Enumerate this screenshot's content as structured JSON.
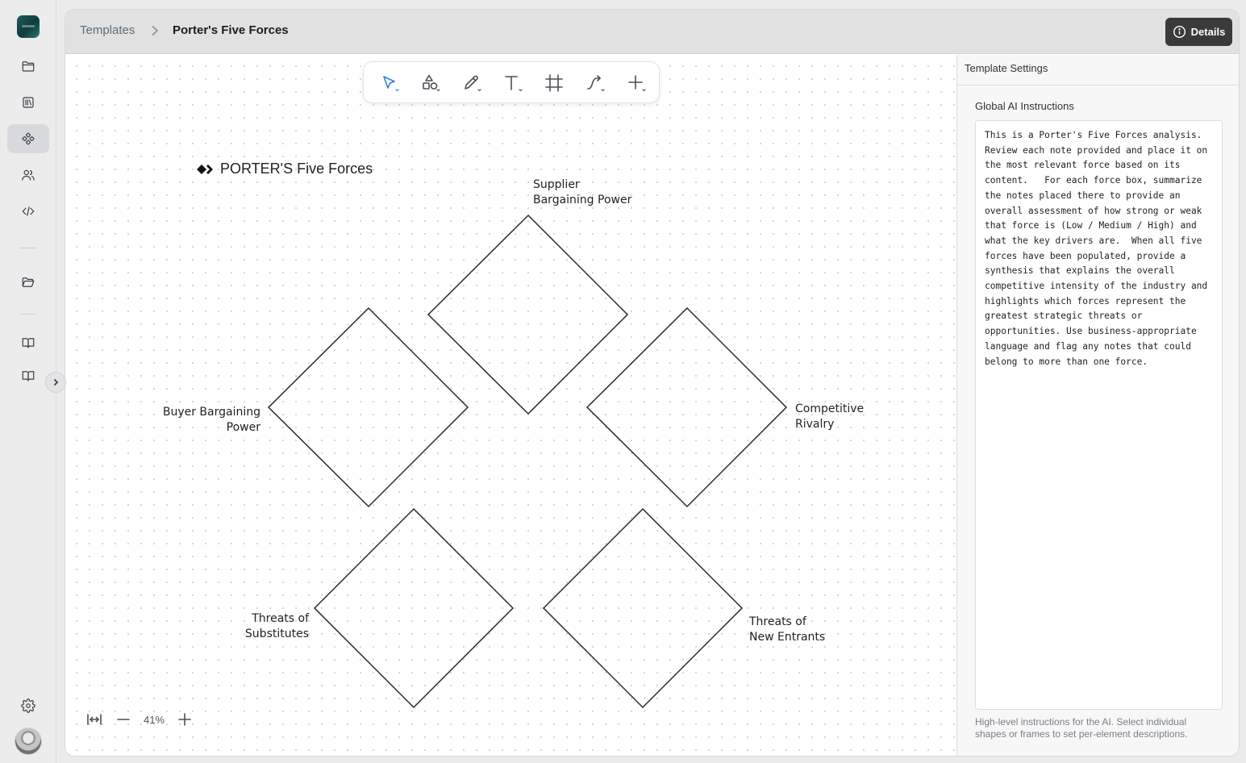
{
  "breadcrumb": {
    "parent": "Templates",
    "current": "Porter's Five Forces"
  },
  "header": {
    "details_label": "Details"
  },
  "sidebar": {
    "items": [
      {
        "icon": "folder-icon"
      },
      {
        "icon": "library-icon"
      },
      {
        "icon": "templates-icon",
        "active": true
      },
      {
        "icon": "users-icon"
      },
      {
        "icon": "code-icon"
      },
      {
        "icon": "folder-open-icon"
      },
      {
        "icon": "book-icon"
      },
      {
        "icon": "book-open-icon"
      }
    ],
    "settings_icon": "gear-icon"
  },
  "toolbar": {
    "tools": [
      "select-tool",
      "shapes-tool",
      "pen-tool",
      "text-tool",
      "frame-tool",
      "connector-tool",
      "add-tool"
    ],
    "active_tool": "select-tool",
    "accent_color": "#2f7fd8"
  },
  "canvas": {
    "title": "PORTER'S Five Forces",
    "forces": {
      "supplier": "Supplier\nBargaining Power",
      "buyer": "Buyer Bargaining\nPower",
      "rivalry": "Competitive\nRivalry",
      "substitutes": "Threats of\nSubstitutes",
      "new_entrants": "Threats of\nNew Entrants"
    }
  },
  "zoom": {
    "value": "41%"
  },
  "settings_panel": {
    "title": "Template Settings",
    "ai_label": "Global AI Instructions",
    "ai_instructions": "This is a Porter's Five Forces analysis. Review each note provided and place it on the most relevant force based on its content.   For each force box, summarize the notes placed there to provide an overall assessment of how strong or weak that force is (Low / Medium / High) and what the key drivers are.  When all five forces have been populated, provide a synthesis that explains the overall competitive intensity of the industry and highlights which forces represent the greatest strategic threats or opportunities. Use business-appropriate language and flag any notes that could belong to more than one force.",
    "help": "High-level instructions for the AI. Select individual shapes or frames to set per-element descriptions."
  }
}
